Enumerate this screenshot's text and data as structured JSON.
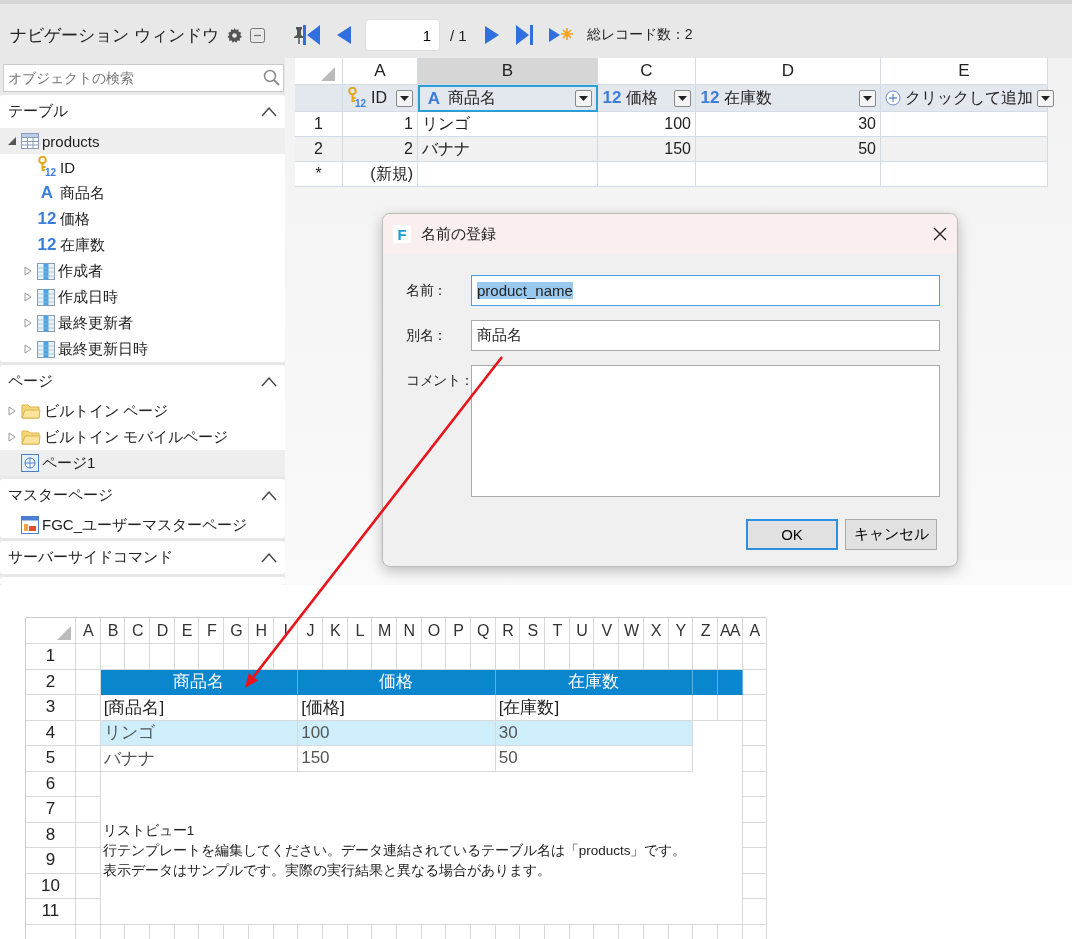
{
  "sidebar": {
    "title": "ナビゲーション ウィンドウ",
    "search": {
      "placeholder": "オブジェクトの検索"
    },
    "sections": [
      {
        "title": "テーブル",
        "expanded": true,
        "items": [
          {
            "label": "products",
            "kind": "table",
            "selected": true,
            "expanded": true,
            "children": [
              {
                "label": "ID",
                "kind": "key",
                "icon": "12",
                "selected": false
              },
              {
                "label": "商品名",
                "kind": "text",
                "icon": "A",
                "selected": false
              },
              {
                "label": "価格",
                "kind": "number",
                "icon": "12",
                "selected": false
              },
              {
                "label": "在庫数",
                "kind": "number",
                "icon": "12",
                "selected": false
              },
              {
                "label": "作成者",
                "kind": "relation",
                "selected": false,
                "expanded": false
              },
              {
                "label": "作成日時",
                "kind": "relation",
                "selected": false,
                "expanded": false
              },
              {
                "label": "最終更新者",
                "kind": "relation",
                "selected": false,
                "expanded": false
              },
              {
                "label": "最終更新日時",
                "kind": "relation",
                "selected": false,
                "expanded": false
              }
            ]
          }
        ]
      },
      {
        "title": "ページ",
        "expanded": true,
        "items": [
          {
            "label": "ビルトイン ページ",
            "kind": "folder",
            "selected": false,
            "expanded": false
          },
          {
            "label": "ビルトイン モバイルページ",
            "kind": "folder",
            "selected": false,
            "expanded": false
          },
          {
            "label": "ページ1",
            "kind": "page",
            "selected": true
          }
        ]
      },
      {
        "title": "マスターページ",
        "expanded": true,
        "items": [
          {
            "label": "FGC_ユーザーマスターページ",
            "kind": "master",
            "selected": false
          }
        ]
      },
      {
        "title": "サーバーサイドコマンド",
        "expanded": true
      }
    ]
  },
  "navigator": {
    "current_page": "1",
    "total": "/ 1",
    "record_count": "総レコード数：2"
  },
  "table": {
    "columns": [
      {
        "letter": "A",
        "field": "ID",
        "kind": "key",
        "icon": "12",
        "selected": false
      },
      {
        "letter": "B",
        "field": "商品名",
        "kind": "text",
        "icon": "A",
        "selected": true
      },
      {
        "letter": "C",
        "field": "価格",
        "kind": "number",
        "icon": "12",
        "selected": false
      },
      {
        "letter": "D",
        "field": "在庫数",
        "kind": "number",
        "icon": "12",
        "selected": false
      },
      {
        "letter": "E",
        "field": "クリックして追加",
        "kind": "add",
        "selected": false
      }
    ],
    "rows": [
      {
        "number": "1",
        "cells": [
          "1",
          "リンゴ",
          "100",
          "30"
        ]
      },
      {
        "number": "2",
        "cells": [
          "2",
          "バナナ",
          "150",
          "50"
        ]
      },
      {
        "number": "*",
        "cells": [
          "(新規)"
        ]
      }
    ]
  },
  "dialog": {
    "app_icon": "F",
    "title": "名前の登録",
    "fields": [
      {
        "label": "名前：",
        "kind": "text",
        "value": "product_name",
        "focused": true,
        "value_selected": true
      },
      {
        "label": "別名：",
        "kind": "text",
        "value": "商品名",
        "focused": false,
        "value_selected": false
      },
      {
        "label": "コメント：",
        "kind": "multiline",
        "focused": false
      }
    ],
    "buttons": [
      {
        "label": "OK",
        "default": true
      },
      {
        "label": "キャンセル",
        "default": false
      }
    ]
  },
  "designer": {
    "columns": [
      "A",
      "B",
      "C",
      "D",
      "E",
      "F",
      "G",
      "H",
      "I",
      "J",
      "K",
      "L",
      "M",
      "N",
      "O",
      "P",
      "Q",
      "R",
      "S",
      "T",
      "U",
      "V",
      "W",
      "X",
      "Y",
      "Z",
      "AA",
      "A"
    ],
    "rows": [
      "1",
      "2",
      "3",
      "4",
      "5",
      "6",
      "7",
      "8",
      "9",
      "10",
      "11"
    ],
    "header": [
      "商品名",
      "価格",
      "在庫数"
    ],
    "template": [
      "[商品名]",
      "[価格]",
      "[在庫数]"
    ],
    "sample_rows": [
      {
        "cells": [
          "リンゴ",
          "100",
          "30"
        ],
        "highlighted": true
      },
      {
        "cells": [
          "バナナ",
          "150",
          "50"
        ],
        "highlighted": false
      }
    ],
    "notes": [
      "リストビュー1",
      "行テンプレートを編集してください。データ連結されているテーブル名は「products」です。",
      "表示データはサンプルです。実際の実行結果と異なる場合があります。"
    ]
  }
}
